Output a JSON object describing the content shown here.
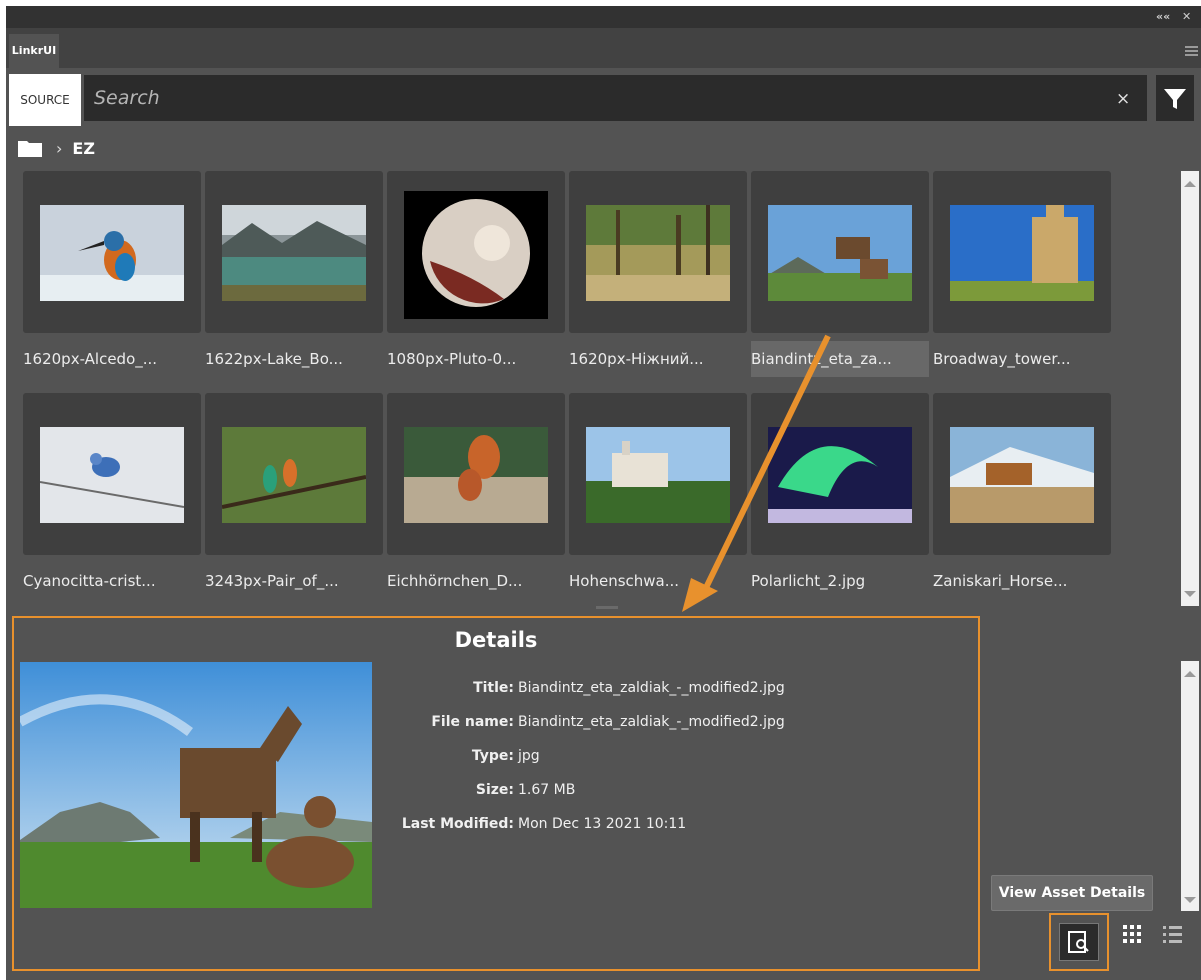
{
  "window": {
    "collapse_label": "««",
    "close_label": "✕"
  },
  "tab": {
    "label": "LinkrUI"
  },
  "toolbar": {
    "source_label": "SOURCE",
    "search_placeholder": "Search",
    "clear_label": "×"
  },
  "breadcrumb": {
    "folder": "EZ"
  },
  "assets": [
    {
      "name": "1620px-Alcedo_..."
    },
    {
      "name": "1622px-Lake_Bo..."
    },
    {
      "name": "1080px-Pluto-0..."
    },
    {
      "name": "1620px-Ніжний..."
    },
    {
      "name": "Biandintz_eta_za...",
      "selected": true
    },
    {
      "name": "Broadway_tower..."
    },
    {
      "name": "Cyanocitta-crist..."
    },
    {
      "name": "3243px-Pair_of_..."
    },
    {
      "name": "Eichhörnchen_D..."
    },
    {
      "name": "Hohenschwa..."
    },
    {
      "name": "Polarlicht_2.jpg"
    },
    {
      "name": "Zaniskari_Horse..."
    }
  ],
  "details": {
    "heading": "Details",
    "fields": [
      {
        "label": "Title:",
        "value": "Biandintz_eta_zaldiak_-_modified2.jpg"
      },
      {
        "label": "File name:",
        "value": "Biandintz_eta_zaldiak_-_modified2.jpg"
      },
      {
        "label": "Type:",
        "value": "jpg"
      },
      {
        "label": "Size:",
        "value": "1.67 MB"
      },
      {
        "label": "Last Modified:",
        "value": "Mon Dec 13 2021 10:11"
      }
    ]
  },
  "tooltip": {
    "label": "View Asset Details"
  },
  "colors": {
    "accent": "#e8912d",
    "panel": "#535353",
    "dark": "#2b2b2b"
  }
}
